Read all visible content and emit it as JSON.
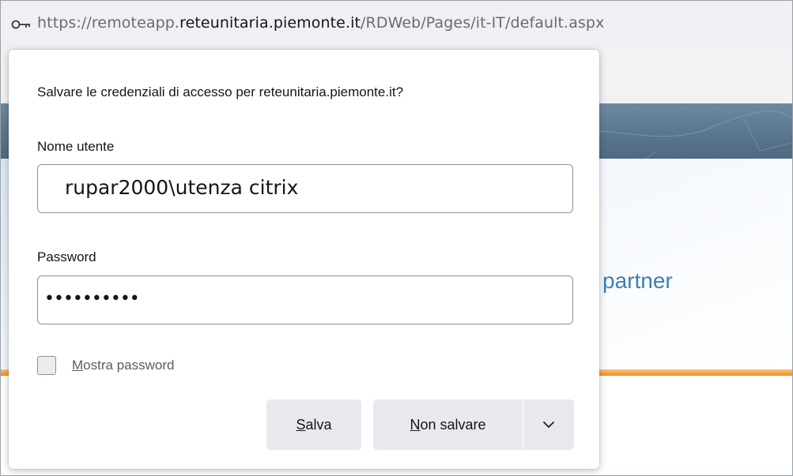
{
  "browser": {
    "url_prefix": "https://remoteapp.",
    "url_host": "reteunitaria.piemonte.it",
    "url_path": "/RDWeb/Pages/it-IT/default.aspx"
  },
  "background_page": {
    "partner_text": "l partner",
    "accent_color": "#f28c1e"
  },
  "save_login_popup": {
    "question": "Salvare le credenziali di accesso per reteunitaria.piemonte.it?",
    "username_label": "Nome utente",
    "username_value": "rupar2000\\utenza citrix",
    "password_label": "Password",
    "password_value": "••••••••••",
    "show_password_label": "Mostra password",
    "show_password_checked": false,
    "save_label": "Salva",
    "dont_save_label": "Non salvare",
    "more_options_icon": "chevron-down-icon"
  }
}
